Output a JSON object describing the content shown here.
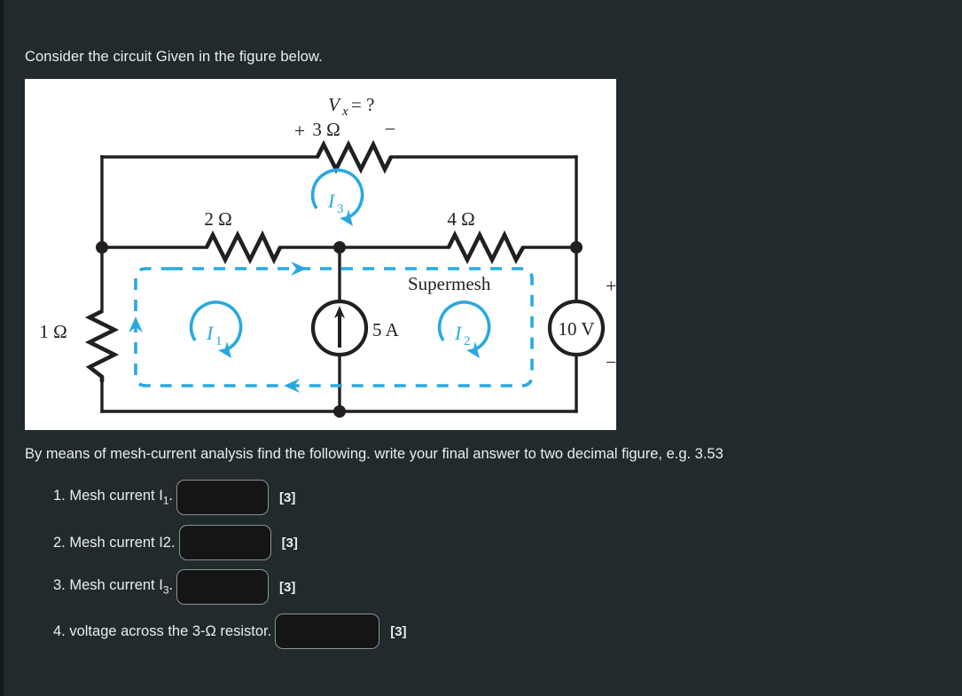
{
  "page": {
    "background_color": "#212b2e",
    "text_color": "#e8eef0",
    "prompt": "Consider the circuit Given in the figure below.",
    "question": "By means of mesh-current analysis find  the following. write your final answer to two decimal figure, e.g. 3.53"
  },
  "figure": {
    "background_color": "#ffffff",
    "wire_color": "#231f20",
    "mesh_color": "#29a8e0",
    "labels": {
      "vx": "V",
      "vx_sub": "x",
      "vx_eq": "= ?",
      "r3": "3 Ω",
      "r3_plus": "+",
      "r3_minus": "−",
      "r2": "2 Ω",
      "r1": "1 Ω",
      "r4": "4 Ω",
      "source_current": "5 A",
      "source_voltage": "10 V",
      "source_voltage_plus": "+",
      "source_voltage_minus": "−",
      "supermesh": "Supermesh",
      "mesh1": "I",
      "mesh1_sub": "1",
      "mesh2": "I",
      "mesh2_sub": "2",
      "mesh3": "I",
      "mesh3_sub": "3"
    }
  },
  "answers": [
    {
      "label_pre": "1. Mesh current I",
      "label_sub": "1",
      "label_post": ".",
      "value": "",
      "placeholder": "",
      "marks": "[3]"
    },
    {
      "label_pre": "2. Mesh current I2.",
      "label_sub": "",
      "label_post": "",
      "value": "",
      "placeholder": "",
      "marks": "[3]"
    },
    {
      "label_pre": "3. Mesh current I",
      "label_sub": "3",
      "label_post": ".",
      "value": "",
      "placeholder": "",
      "marks": "[3]"
    },
    {
      "label_pre": "4. voltage across the 3-Ω resistor.",
      "label_sub": "",
      "label_post": "",
      "value": "",
      "placeholder": "",
      "marks": "[3]"
    }
  ]
}
